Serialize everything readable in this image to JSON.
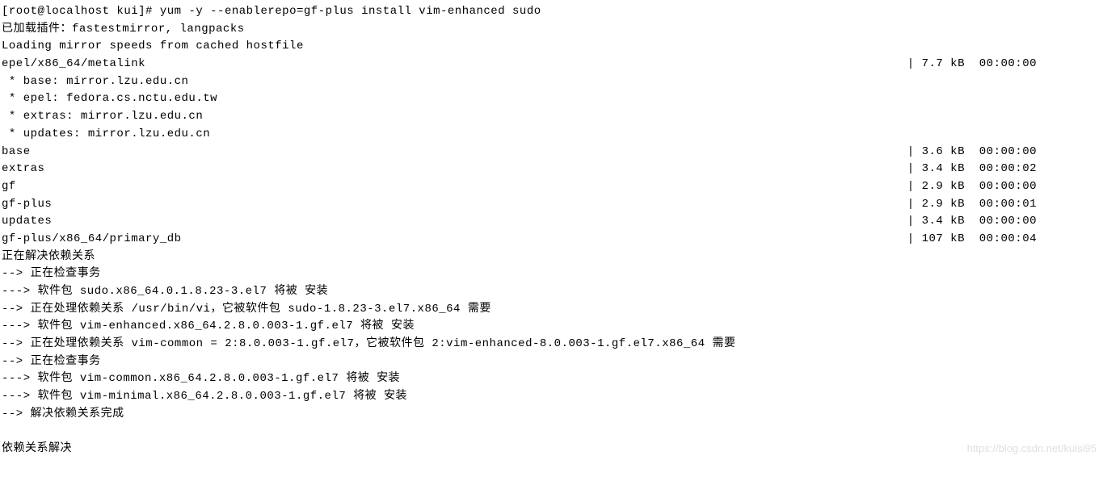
{
  "prompt": "[root@localhost kui]# ",
  "command": "yum -y --enablerepo=gf-plus install vim-enhanced sudo",
  "lines": {
    "l1": "已加载插件：fastestmirror, langpacks",
    "l2": "Loading mirror speeds from cached hostfile",
    "mirrors": {
      "base": " * base: mirror.lzu.edu.cn",
      "epel": " * epel: fedora.cs.nctu.edu.tw",
      "extras": " * extras: mirror.lzu.edu.cn",
      "updates": " * updates: mirror.lzu.edu.cn"
    },
    "repos": [
      {
        "name": "epel/x86_64/metalink",
        "size": "| 7.7 kB  00:00:00"
      },
      {
        "name": "base",
        "size": "| 3.6 kB  00:00:00"
      },
      {
        "name": "extras",
        "size": "| 3.4 kB  00:00:02"
      },
      {
        "name": "gf",
        "size": "| 2.9 kB  00:00:00"
      },
      {
        "name": "gf-plus",
        "size": "| 2.9 kB  00:00:01"
      },
      {
        "name": "updates",
        "size": "| 3.4 kB  00:00:00"
      },
      {
        "name": "gf-plus/x86_64/primary_db",
        "size": "| 107 kB  00:00:04"
      }
    ],
    "resolve_header": "正在解决依赖关系",
    "deps": [
      "--> 正在检查事务",
      "---> 软件包 sudo.x86_64.0.1.8.23-3.el7 将被 安装",
      "--> 正在处理依赖关系 /usr/bin/vi，它被软件包 sudo-1.8.23-3.el7.x86_64 需要",
      "---> 软件包 vim-enhanced.x86_64.2.8.0.003-1.gf.el7 将被 安装",
      "--> 正在处理依赖关系 vim-common = 2:8.0.003-1.gf.el7，它被软件包 2:vim-enhanced-8.0.003-1.gf.el7.x86_64 需要",
      "--> 正在检查事务",
      "---> 软件包 vim-common.x86_64.2.8.0.003-1.gf.el7 将被 安装",
      "---> 软件包 vim-minimal.x86_64.2.8.0.003-1.gf.el7 将被 安装",
      "--> 解决依赖关系完成"
    ],
    "footer": "依赖关系解决"
  },
  "watermark": "https://blog.csdn.net/kuisi95"
}
